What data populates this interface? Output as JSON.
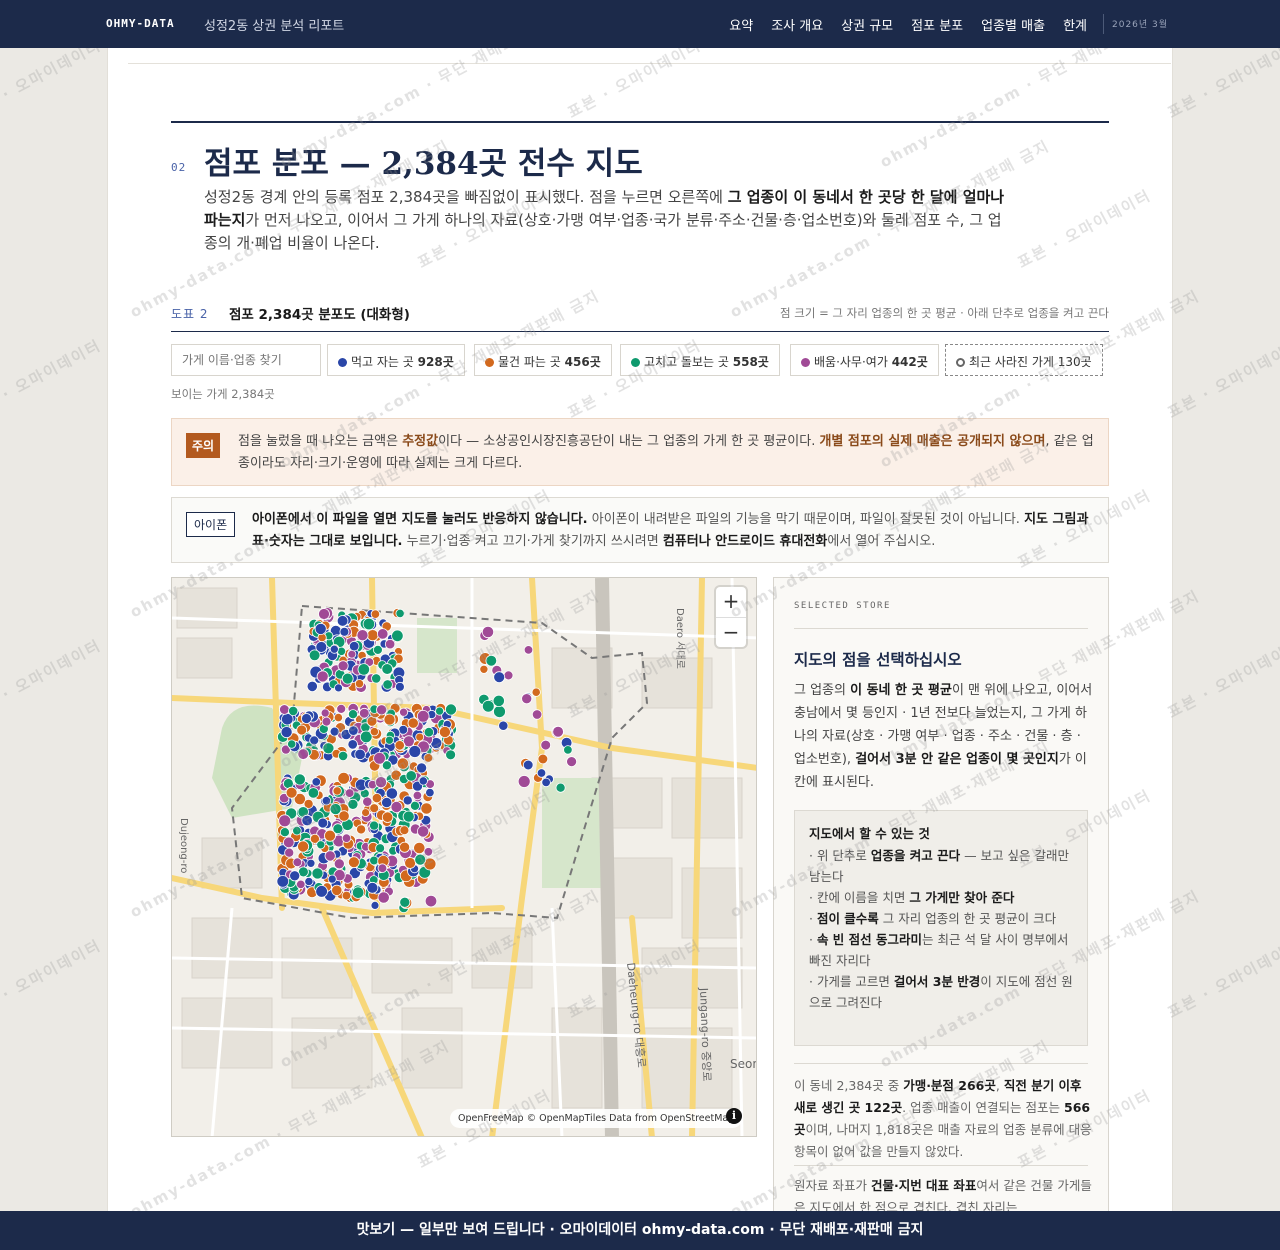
{
  "nav": {
    "brand": "OHMY-DATA",
    "subtitle": "성정2동 상권 분석 리포트",
    "links": [
      "요약",
      "조사 개요",
      "상권 규모",
      "점포 분포",
      "업종별 매출",
      "한계"
    ],
    "date": "2026년 3월"
  },
  "section": {
    "number": "02",
    "title": "점포 분포 — 2,384곳 전수 지도",
    "intro_a": "성정2동 경계 안의 등록 점포 2,384곳을 빠짐없이 표시했다. 점을 누르면 오른쪽에 ",
    "intro_b": "그 업종이 이 동네서 한 곳당 한 달에 얼마나 파는지",
    "intro_c": "가 먼저 나오고, 이어서 그 가게 하나의 자료(상호·가맹 여부·업종·국가 분류·주소·건물·층·업소번호)와 둘레 점포 수, 그 업종의 개·폐업 비율이 나온다."
  },
  "figure": {
    "label": "도표 2",
    "title": "점포 2,384곳 분포도 (대화형)",
    "note": "점 크기 = 그 자리 업종의 한 곳 평균 · 아래 단추로 업종을 켜고 끈다"
  },
  "filters": {
    "search_placeholder": "가게 이름·업종 찾기",
    "chips": [
      {
        "label": "먹고 자는 곳",
        "count": "928곳",
        "color": "#2a46a8"
      },
      {
        "label": "물건 파는 곳",
        "count": "456곳",
        "color": "#d2691e"
      },
      {
        "label": "고치고 돌보는 곳",
        "count": "558곳",
        "color": "#0f9a6e"
      },
      {
        "label": "배움·사무·여가",
        "count": "442곳",
        "color": "#a04a96"
      },
      {
        "label": "최근 사라진 가게",
        "count": "130곳",
        "color": "#666666"
      }
    ],
    "visible": "보이는 가게 2,384곳"
  },
  "warning": {
    "tag": "주의",
    "t1": "점을 눌렀을 때 나오는 금액은 ",
    "t2": "추정값",
    "t3": "이다 — 소상공인시장진흥공단이 내는 그 업종의 가게 한 곳 평균이다. ",
    "t4": "개별 점포의 실제 매출은 공개되지 않으며",
    "t5": ", 같은 업종이라도 자리·크기·운영에 따라 실제는 크게 다르다."
  },
  "iphone": {
    "tag": "아이폰",
    "t1": "아이폰에서 이 파일을 열면 지도를 눌러도 반응하지 않습니다.",
    "t2": " 아이폰이 내려받은 파일의 기능을 막기 때문이며, 파일이 잘못된 것이 아닙니다. ",
    "t3": "지도 그림과 표·숫자는 그대로 보입니다.",
    "t4": " 누르기·업종 켜고 끄기·가게 찾기까지 쓰시려면 ",
    "t5": "컴퓨터나 안드로이드 휴대전화",
    "t6": "에서 열어 주십시오."
  },
  "map": {
    "zoom_in": "+",
    "zoom_out": "−",
    "attribution": "OpenFreeMap © OpenMapTiles Data from OpenStreetMap",
    "info": "i",
    "labels": [
      "Daero 서대로",
      "Dujeong-ro",
      "Daeheung-ro 대흥로",
      "Jungang-ro 중앙로",
      "Seon"
    ]
  },
  "panel": {
    "eyebrow": "SELECTED STORE",
    "title": "지도의 점을 선택하십시오",
    "b1": "그 업종의 ",
    "b2": "이 동네 한 곳 평균",
    "b3": "이 맨 위에 나오고, 이어서 충남에서 몇 등인지 · 1년 전보다 늘었는지, 그 가게 하나의 자료(상호 · 가맹 여부 · 업종 · 주소 · 건물 · 층 · 업소번호), ",
    "b4": "걸어서 3분 안 같은 업종이 몇 곳인지",
    "b5": "가 이 칸에 표시된다.",
    "howto_title": "지도에서 할 수 있는 것",
    "howto_items": [
      {
        "pre": "· 위 단추로 ",
        "em": "업종을 켜고 끈다",
        "post": " — 보고 싶은 갈래만 남는다"
      },
      {
        "pre": "· 칸에 이름을 치면 ",
        "em": "그 가게만 찾아 준다",
        "post": ""
      },
      {
        "pre": "· ",
        "em": "점이 클수록",
        "post": " 그 자리 업종의 한 곳 평균이 크다"
      },
      {
        "pre": "· ",
        "em": "속 빈 점선 동그라미",
        "post": "는 최근 석 달 사이 명부에서 빠진 자리다"
      },
      {
        "pre": "· 가게를 고르면 ",
        "em": "걸어서 3분 반경",
        "post": "이 지도에 점선 원으로 그려진다"
      }
    ],
    "s1": "이 동네 2,384곳 중 ",
    "s2": "가맹·분점 266곳",
    "s3": ", ",
    "s4": "직전 분기 이후 새로 생긴 곳 122곳",
    "s5": ". 업종 매출이 연결되는 점포는 ",
    "s6": "566곳",
    "s7": "이며, 나머지 1,818곳은 매출 자료의 업종 분류에 대응 항목이 없어 값을 만들지 않았다.",
    "src1": "원자료 좌표가 ",
    "src2": "건물·지번 대표 좌표",
    "src3": "여서 같은 건물 가게들은 지도에서 한 점으로 겹친다. 겹친 자리는"
  },
  "watermark": {
    "a": "표본 · 오마이데이터",
    "b": "ohmy-data.com · 무단 재배포·재판매 금지"
  },
  "footer": {
    "text": "맛보기 — 일부만 보여 드립니다 · 오마이데이터 ohmy-data.com · 무단 재배포·재판매 금지"
  }
}
